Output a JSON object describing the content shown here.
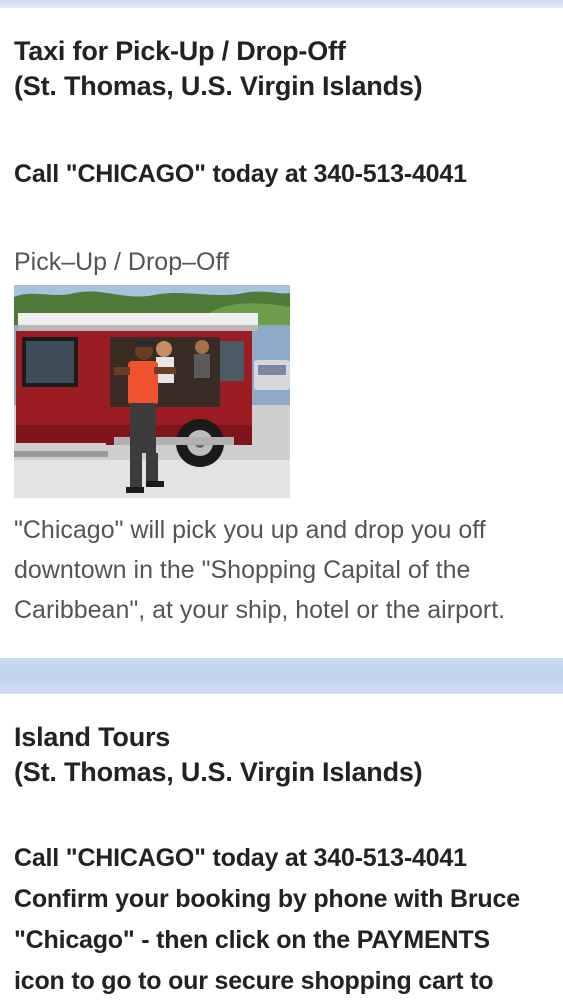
{
  "taxi_section": {
    "title_line1": "Taxi for Pick-Up / Drop-Off",
    "title_line2": "(St. Thomas, U.S. Virgin Islands)",
    "call": "Call \"CHICAGO\" today at 340-513-4041",
    "photo_caption": "Pick–Up / Drop–Off",
    "description_lines": [
      "\"Chicago\" will pick you up and drop you off",
      "downtown in the \"Shopping Capital of the",
      "Caribbean\", at your ship, hotel or the airport."
    ]
  },
  "tours_section": {
    "title_line1": "Island Tours",
    "title_line2": "(St. Thomas, U.S. Virgin Islands)",
    "text_lines": [
      "Call \"CHICAGO\" today at 340-513-4041",
      "Confirm your booking by phone with Bruce",
      "\"Chicago\" - then click on the PAYMENTS",
      "icon to go to our secure shopping cart to"
    ]
  },
  "colors": {
    "band": "#c8daf0",
    "heading_text": "#222222",
    "body_text": "#555555",
    "van_red": "#9b1c22"
  }
}
